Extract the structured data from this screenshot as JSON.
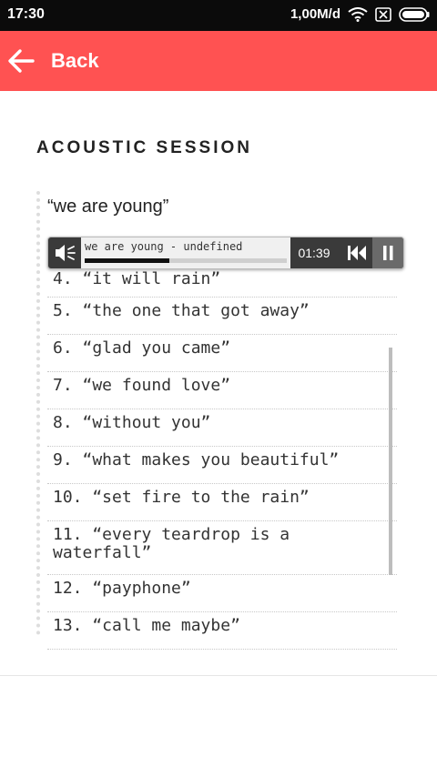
{
  "status_bar": {
    "time": "17:30",
    "network_speed": "1,00M/d",
    "icons": [
      "wifi-icon",
      "sim-icon",
      "battery-icon"
    ]
  },
  "app_bar": {
    "back_label": "Back",
    "back_icon": "arrow-left-icon",
    "color": "#ff5252"
  },
  "page": {
    "title": "ACOUSTIC SESSION"
  },
  "player": {
    "current_title": "“we are young”",
    "track_label": "we are young - undefined",
    "elapsed": "01:39",
    "progress_percent": 42,
    "controls": [
      "mute-icon",
      "previous-icon",
      "pause-icon"
    ]
  },
  "tracks": [
    "4. “it will rain”",
    "5. “the one that got away”",
    "6. “glad you came”",
    "7. “we found love”",
    "8. “without you”",
    "9. “what makes you beautiful”",
    "10. “set fire to the rain”",
    "11. “every teardrop is a waterfall”",
    "12. “payphone”",
    "13. “call me maybe”"
  ]
}
